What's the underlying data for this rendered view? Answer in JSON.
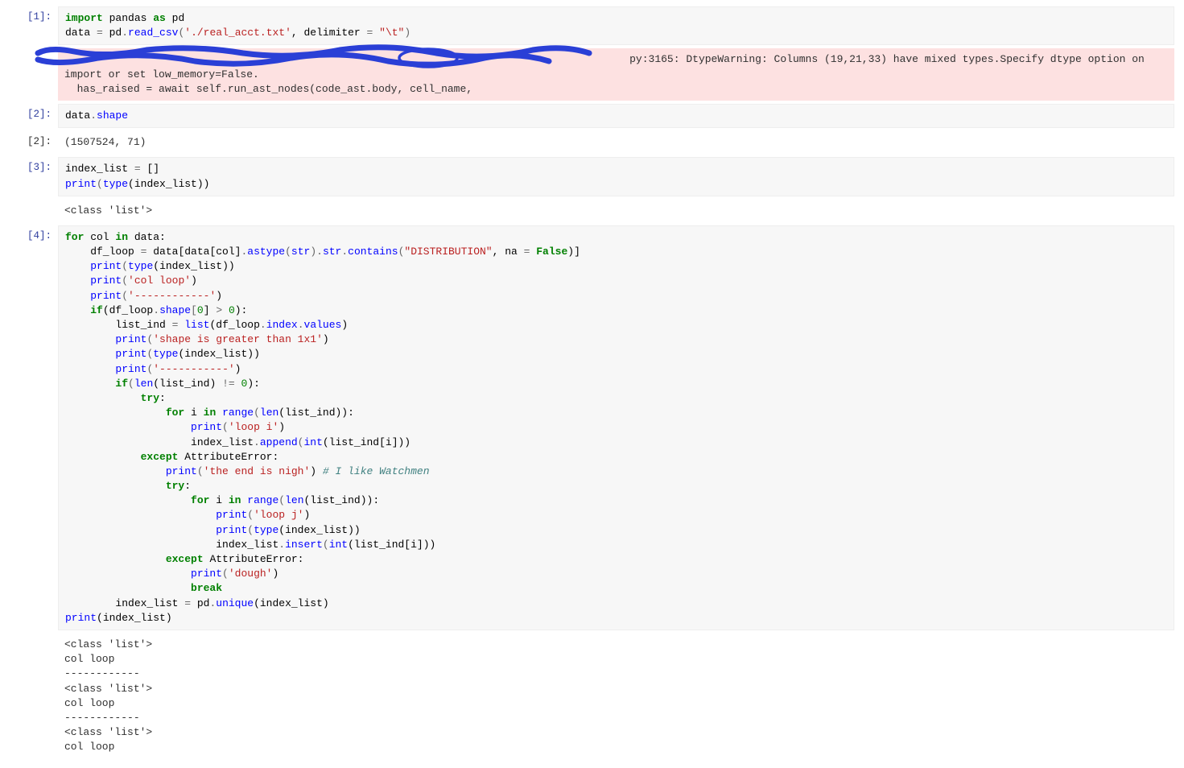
{
  "cells": [
    {
      "prompt": "[1]:",
      "type": "code",
      "tokens": [
        {
          "t": "import",
          "c": "kw"
        },
        {
          "t": " pandas ",
          "c": "nm"
        },
        {
          "t": "as",
          "c": "kw"
        },
        {
          "t": " pd\n",
          "c": "nm"
        },
        {
          "t": "data ",
          "c": "nm"
        },
        {
          "t": "=",
          "c": "op"
        },
        {
          "t": " pd",
          "c": "nm"
        },
        {
          "t": ".",
          "c": "op"
        },
        {
          "t": "read_csv",
          "c": "attr"
        },
        {
          "t": "(",
          "c": "op"
        },
        {
          "t": "'./real_acct.txt'",
          "c": "st"
        },
        {
          "t": ", delimiter ",
          "c": "nm"
        },
        {
          "t": "=",
          "c": "op"
        },
        {
          "t": " ",
          "c": "nm"
        },
        {
          "t": "\"\\t\"",
          "c": "st"
        },
        {
          "t": ")",
          "c": "op"
        }
      ]
    },
    {
      "prompt": "",
      "type": "warning",
      "text": "                                                                                          py:3165: DtypeWarning: Columns (19,21,33) have mixed types.Specify dtype option on import or set low_memory=False.\n  has_raised = await self.run_ast_nodes(code_ast.body, cell_name,"
    },
    {
      "prompt": "[2]:",
      "type": "code",
      "tokens": [
        {
          "t": "data",
          "c": "nm"
        },
        {
          "t": ".",
          "c": "op"
        },
        {
          "t": "shape",
          "c": "attr"
        }
      ]
    },
    {
      "prompt": "[2]:",
      "type": "output",
      "text": "(1507524, 71)"
    },
    {
      "prompt": "[3]:",
      "type": "code",
      "tokens": [
        {
          "t": "index_list ",
          "c": "nm"
        },
        {
          "t": "=",
          "c": "op"
        },
        {
          "t": " []\n",
          "c": "nm"
        },
        {
          "t": "print",
          "c": "fn"
        },
        {
          "t": "(",
          "c": "op"
        },
        {
          "t": "type",
          "c": "fn"
        },
        {
          "t": "(index_list))",
          "c": "nm"
        }
      ]
    },
    {
      "prompt": "",
      "type": "output",
      "text": "<class 'list'>"
    },
    {
      "prompt": "[4]:",
      "type": "code",
      "tokens": [
        {
          "t": "for",
          "c": "kw"
        },
        {
          "t": " col ",
          "c": "nm"
        },
        {
          "t": "in",
          "c": "kw"
        },
        {
          "t": " data:\n",
          "c": "nm"
        },
        {
          "t": "    df_loop ",
          "c": "nm"
        },
        {
          "t": "=",
          "c": "op"
        },
        {
          "t": " data[data[col]",
          "c": "nm"
        },
        {
          "t": ".",
          "c": "op"
        },
        {
          "t": "astype",
          "c": "attr"
        },
        {
          "t": "(",
          "c": "op"
        },
        {
          "t": "str",
          "c": "fn"
        },
        {
          "t": ")",
          "c": "op"
        },
        {
          "t": ".",
          "c": "op"
        },
        {
          "t": "str",
          "c": "attr"
        },
        {
          "t": ".",
          "c": "op"
        },
        {
          "t": "contains",
          "c": "attr"
        },
        {
          "t": "(",
          "c": "op"
        },
        {
          "t": "\"DISTRIBUTION\"",
          "c": "st"
        },
        {
          "t": ", na ",
          "c": "nm"
        },
        {
          "t": "=",
          "c": "op"
        },
        {
          "t": " ",
          "c": "nm"
        },
        {
          "t": "False",
          "c": "bn"
        },
        {
          "t": ")]\n",
          "c": "nm"
        },
        {
          "t": "    ",
          "c": "nm"
        },
        {
          "t": "print",
          "c": "fn"
        },
        {
          "t": "(",
          "c": "op"
        },
        {
          "t": "type",
          "c": "fn"
        },
        {
          "t": "(index_list))\n",
          "c": "nm"
        },
        {
          "t": "    ",
          "c": "nm"
        },
        {
          "t": "print",
          "c": "fn"
        },
        {
          "t": "(",
          "c": "op"
        },
        {
          "t": "'col loop'",
          "c": "st"
        },
        {
          "t": ")\n",
          "c": "nm"
        },
        {
          "t": "    ",
          "c": "nm"
        },
        {
          "t": "print",
          "c": "fn"
        },
        {
          "t": "(",
          "c": "op"
        },
        {
          "t": "'------------'",
          "c": "st"
        },
        {
          "t": ")\n",
          "c": "nm"
        },
        {
          "t": "    ",
          "c": "nm"
        },
        {
          "t": "if",
          "c": "kw"
        },
        {
          "t": "(df_loop",
          "c": "nm"
        },
        {
          "t": ".",
          "c": "op"
        },
        {
          "t": "shape",
          "c": "attr"
        },
        {
          "t": "[",
          "c": "op"
        },
        {
          "t": "0",
          "c": "num"
        },
        {
          "t": "] ",
          "c": "nm"
        },
        {
          "t": ">",
          "c": "op"
        },
        {
          "t": " ",
          "c": "nm"
        },
        {
          "t": "0",
          "c": "num"
        },
        {
          "t": "):\n",
          "c": "nm"
        },
        {
          "t": "        list_ind ",
          "c": "nm"
        },
        {
          "t": "=",
          "c": "op"
        },
        {
          "t": " ",
          "c": "nm"
        },
        {
          "t": "list",
          "c": "fn"
        },
        {
          "t": "(df_loop",
          "c": "nm"
        },
        {
          "t": ".",
          "c": "op"
        },
        {
          "t": "index",
          "c": "attr"
        },
        {
          "t": ".",
          "c": "op"
        },
        {
          "t": "values",
          "c": "attr"
        },
        {
          "t": ")\n",
          "c": "nm"
        },
        {
          "t": "        ",
          "c": "nm"
        },
        {
          "t": "print",
          "c": "fn"
        },
        {
          "t": "(",
          "c": "op"
        },
        {
          "t": "'shape is greater than 1x1'",
          "c": "st"
        },
        {
          "t": ")\n",
          "c": "nm"
        },
        {
          "t": "        ",
          "c": "nm"
        },
        {
          "t": "print",
          "c": "fn"
        },
        {
          "t": "(",
          "c": "op"
        },
        {
          "t": "type",
          "c": "fn"
        },
        {
          "t": "(index_list))\n",
          "c": "nm"
        },
        {
          "t": "        ",
          "c": "nm"
        },
        {
          "t": "print",
          "c": "fn"
        },
        {
          "t": "(",
          "c": "op"
        },
        {
          "t": "'-----------'",
          "c": "st"
        },
        {
          "t": ")\n",
          "c": "nm"
        },
        {
          "t": "        ",
          "c": "nm"
        },
        {
          "t": "if",
          "c": "kw"
        },
        {
          "t": "(",
          "c": "op"
        },
        {
          "t": "len",
          "c": "fn"
        },
        {
          "t": "(list_ind) ",
          "c": "nm"
        },
        {
          "t": "!=",
          "c": "op"
        },
        {
          "t": " ",
          "c": "nm"
        },
        {
          "t": "0",
          "c": "num"
        },
        {
          "t": "):\n",
          "c": "nm"
        },
        {
          "t": "            ",
          "c": "nm"
        },
        {
          "t": "try",
          "c": "kw"
        },
        {
          "t": ":\n",
          "c": "nm"
        },
        {
          "t": "                ",
          "c": "nm"
        },
        {
          "t": "for",
          "c": "kw"
        },
        {
          "t": " i ",
          "c": "nm"
        },
        {
          "t": "in",
          "c": "kw"
        },
        {
          "t": " ",
          "c": "nm"
        },
        {
          "t": "range",
          "c": "fn"
        },
        {
          "t": "(",
          "c": "op"
        },
        {
          "t": "len",
          "c": "fn"
        },
        {
          "t": "(list_ind)):\n",
          "c": "nm"
        },
        {
          "t": "                    ",
          "c": "nm"
        },
        {
          "t": "print",
          "c": "fn"
        },
        {
          "t": "(",
          "c": "op"
        },
        {
          "t": "'loop i'",
          "c": "st"
        },
        {
          "t": ")\n",
          "c": "nm"
        },
        {
          "t": "                    index_list",
          "c": "nm"
        },
        {
          "t": ".",
          "c": "op"
        },
        {
          "t": "append",
          "c": "attr"
        },
        {
          "t": "(",
          "c": "op"
        },
        {
          "t": "int",
          "c": "fn"
        },
        {
          "t": "(list_ind[i]))\n",
          "c": "nm"
        },
        {
          "t": "            ",
          "c": "nm"
        },
        {
          "t": "except",
          "c": "kw"
        },
        {
          "t": " ",
          "c": "nm"
        },
        {
          "t": "AttributeError",
          "c": "nm"
        },
        {
          "t": ":\n",
          "c": "nm"
        },
        {
          "t": "                ",
          "c": "nm"
        },
        {
          "t": "print",
          "c": "fn"
        },
        {
          "t": "(",
          "c": "op"
        },
        {
          "t": "'the end is nigh'",
          "c": "st"
        },
        {
          "t": ") ",
          "c": "nm"
        },
        {
          "t": "# I like Watchmen",
          "c": "cm"
        },
        {
          "t": "\n",
          "c": "nm"
        },
        {
          "t": "                ",
          "c": "nm"
        },
        {
          "t": "try",
          "c": "kw"
        },
        {
          "t": ":\n",
          "c": "nm"
        },
        {
          "t": "                    ",
          "c": "nm"
        },
        {
          "t": "for",
          "c": "kw"
        },
        {
          "t": " i ",
          "c": "nm"
        },
        {
          "t": "in",
          "c": "kw"
        },
        {
          "t": " ",
          "c": "nm"
        },
        {
          "t": "range",
          "c": "fn"
        },
        {
          "t": "(",
          "c": "op"
        },
        {
          "t": "len",
          "c": "fn"
        },
        {
          "t": "(list_ind)):\n",
          "c": "nm"
        },
        {
          "t": "                        ",
          "c": "nm"
        },
        {
          "t": "print",
          "c": "fn"
        },
        {
          "t": "(",
          "c": "op"
        },
        {
          "t": "'loop j'",
          "c": "st"
        },
        {
          "t": ")\n",
          "c": "nm"
        },
        {
          "t": "                        ",
          "c": "nm"
        },
        {
          "t": "print",
          "c": "fn"
        },
        {
          "t": "(",
          "c": "op"
        },
        {
          "t": "type",
          "c": "fn"
        },
        {
          "t": "(index_list))\n",
          "c": "nm"
        },
        {
          "t": "                        index_list",
          "c": "nm"
        },
        {
          "t": ".",
          "c": "op"
        },
        {
          "t": "insert",
          "c": "attr"
        },
        {
          "t": "(",
          "c": "op"
        },
        {
          "t": "int",
          "c": "fn"
        },
        {
          "t": "(list_ind[i]))\n",
          "c": "nm"
        },
        {
          "t": "                ",
          "c": "nm"
        },
        {
          "t": "except",
          "c": "kw"
        },
        {
          "t": " ",
          "c": "nm"
        },
        {
          "t": "AttributeError",
          "c": "nm"
        },
        {
          "t": ":\n",
          "c": "nm"
        },
        {
          "t": "                    ",
          "c": "nm"
        },
        {
          "t": "print",
          "c": "fn"
        },
        {
          "t": "(",
          "c": "op"
        },
        {
          "t": "'dough'",
          "c": "st"
        },
        {
          "t": ")\n",
          "c": "nm"
        },
        {
          "t": "                    ",
          "c": "nm"
        },
        {
          "t": "break",
          "c": "kw"
        },
        {
          "t": "\n",
          "c": "nm"
        },
        {
          "t": "        index_list ",
          "c": "nm"
        },
        {
          "t": "=",
          "c": "op"
        },
        {
          "t": " pd",
          "c": "nm"
        },
        {
          "t": ".",
          "c": "op"
        },
        {
          "t": "unique",
          "c": "attr"
        },
        {
          "t": "(index_list)\n",
          "c": "nm"
        },
        {
          "t": "print",
          "c": "fn"
        },
        {
          "t": "(index_list)",
          "c": "nm"
        }
      ]
    },
    {
      "prompt": "",
      "type": "output",
      "text": "<class 'list'>\ncol loop\n------------\n<class 'list'>\ncol loop\n------------\n<class 'list'>\ncol loop"
    }
  ]
}
